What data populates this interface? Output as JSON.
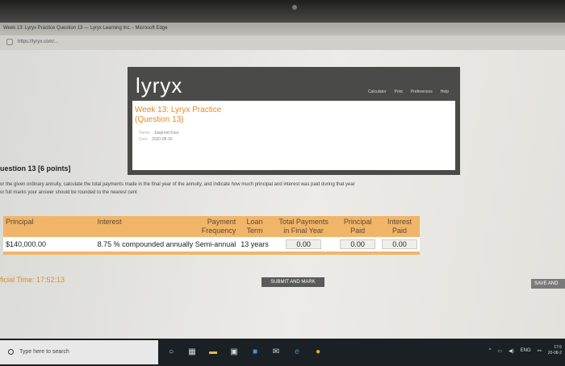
{
  "browser": {
    "title": "Week 13: Lyryx Practice Question 13 — Lyryx Learning Inc. - Microsoft Edge",
    "url": "https://lyryx.com/..."
  },
  "header": {
    "logo": "lyryx",
    "nav": [
      "Calculator",
      "Print",
      "Preferences",
      "Help"
    ],
    "course_line1": "Week 13: Lyryx Practice",
    "course_line2": "(Question 13)",
    "name_key": "Name:",
    "name_value": "Jaspreet Kaur",
    "date_key": "Date:",
    "date_value": "2020-08-20"
  },
  "question": {
    "title": "uestion 13 [6 points]",
    "text_line1": "or the given ordinary annuity, calculate the total payments made in the final year of the annuity, and indicate how much principal and interest was paid during that year",
    "text_line2": "or full marks your answer should be rounded to the nearest cent"
  },
  "table": {
    "headers": {
      "principal": "Principal",
      "interest": "Interest",
      "payment_freq_1": "Payment",
      "payment_freq_2": "Frequency",
      "loan_term_1": "Loan",
      "loan_term_2": "Term",
      "total_payments_1": "Total Payments",
      "total_payments_2": "in Final Year",
      "principal_paid_1": "Principal",
      "principal_paid_2": "Paid",
      "interest_paid_1": "Interest",
      "interest_paid_2": "Paid"
    },
    "row": {
      "principal": "$140,000.00",
      "interest": "8.75 % compounded annually",
      "payment_frequency": "Semi-annual",
      "loan_term": "13 years",
      "total_payments": "0.00",
      "principal_paid": "0.00",
      "interest_paid": "0.00"
    }
  },
  "footer": {
    "timer": "ficial Time: 17:52:13",
    "submit": "SUBMIT AND MARK",
    "save": "SAVE AND"
  },
  "taskbar": {
    "search_placeholder": "Type here to search",
    "lang": "ENG",
    "time": "17:5",
    "date": "20-08-2"
  }
}
